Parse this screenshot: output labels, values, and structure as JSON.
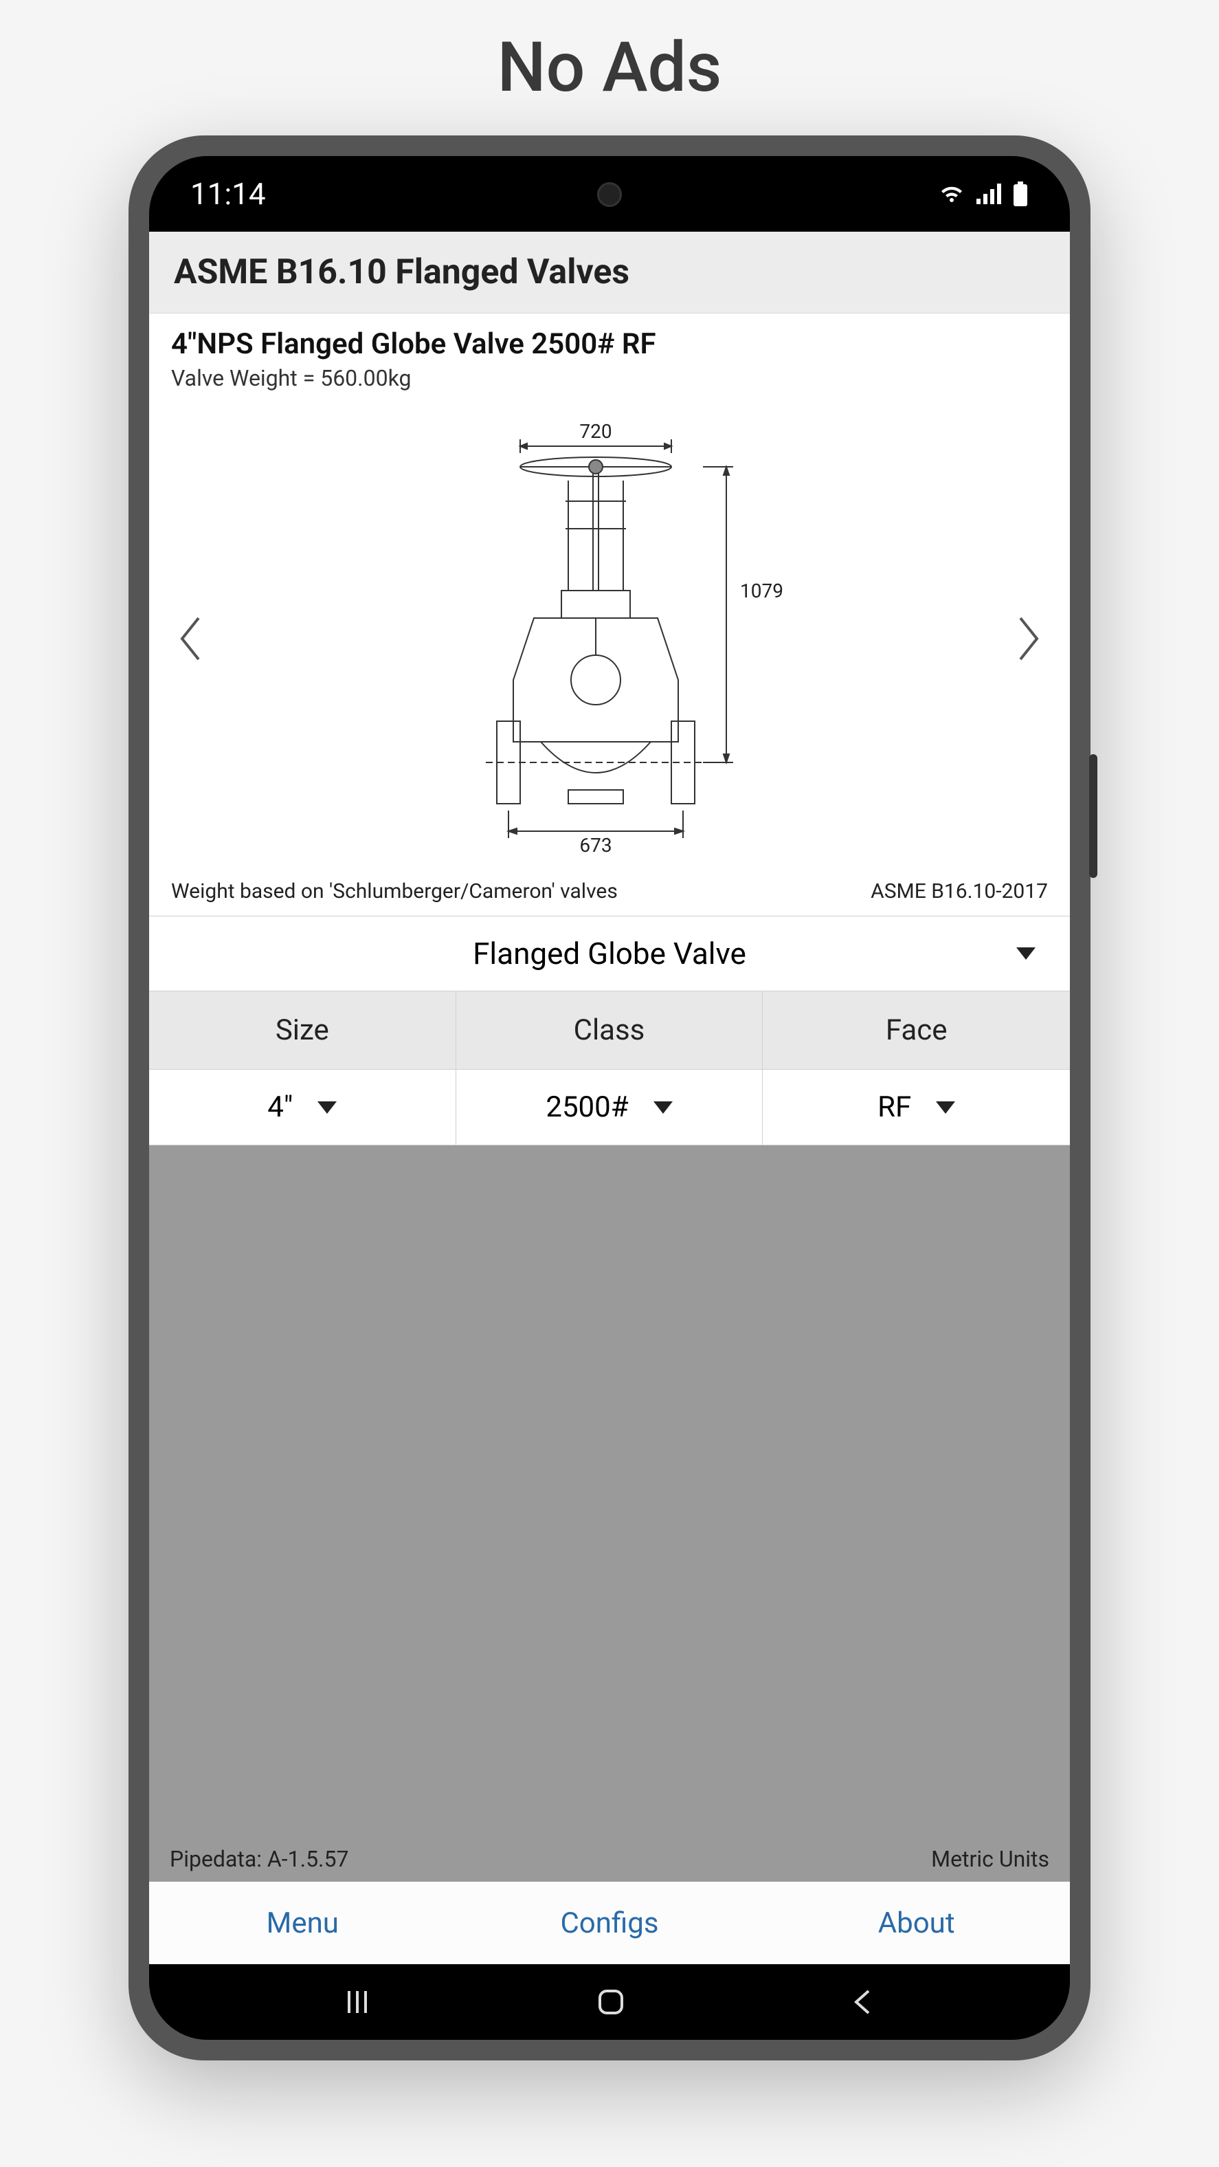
{
  "headline": "No Ads",
  "status": {
    "time": "11:14"
  },
  "app": {
    "title": "ASME B16.10 Flanged Valves",
    "valve_title": "4\"NPS Flanged Globe Valve 2500# RF",
    "valve_weight": "Valve Weight = 560.00kg",
    "footnote_left": "Weight based on 'Schlumberger/Cameron' valves",
    "footnote_right": "ASME B16.10-2017",
    "valve_type": "Flanged Globe Valve",
    "headers": {
      "size": "Size",
      "class": "Class",
      "face": "Face"
    },
    "values": {
      "size": "4\"",
      "class": "2500#",
      "face": "RF"
    },
    "diagram": {
      "top_dim": "720",
      "right_dim": "1079",
      "bottom_dim": "673"
    },
    "bottom_left": "Pipedata: A-1.5.57",
    "bottom_right": "Metric Units",
    "tabs": {
      "menu": "Menu",
      "configs": "Configs",
      "about": "About"
    }
  }
}
